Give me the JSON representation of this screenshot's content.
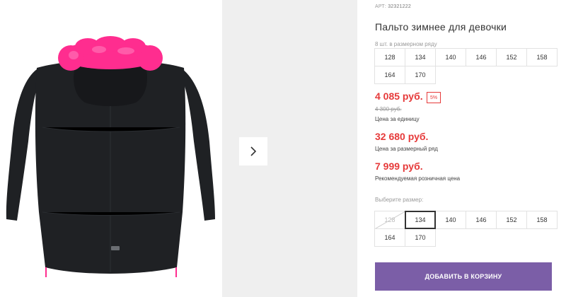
{
  "product": {
    "sku_label": "АРТ:",
    "sku": "32321222",
    "title": "Пальто зимнее для девочки",
    "image_alt": "coat-photo",
    "colors": {
      "accent": "#7b5ea7",
      "price_red": "#e63a3a",
      "coat": "#1f2124",
      "fur": "#ff2d8f"
    }
  },
  "gallery": {
    "next_icon": "chevron-right-icon"
  },
  "pack": {
    "label": "8 шт. в размерном ряду",
    "sizes": [
      "128",
      "134",
      "140",
      "146",
      "152",
      "158",
      "164",
      "170"
    ]
  },
  "prices": {
    "unit": "4 085 руб.",
    "discount": "5%",
    "old": "4 300 руб.",
    "unit_caption": "Цена за единицу",
    "pack": "32 680 руб.",
    "pack_caption": "Цена за размерный ряд",
    "retail": "7 999 руб.",
    "retail_caption": "Рекомендуемая розничная цена"
  },
  "choose": {
    "label": "Выберите размер:",
    "sizes": [
      {
        "value": "128",
        "state": "unavailable"
      },
      {
        "value": "134",
        "state": "selected"
      },
      {
        "value": "140",
        "state": "available"
      },
      {
        "value": "146",
        "state": "available"
      },
      {
        "value": "152",
        "state": "available"
      },
      {
        "value": "158",
        "state": "available"
      },
      {
        "value": "164",
        "state": "available"
      },
      {
        "value": "170",
        "state": "available"
      }
    ]
  },
  "cart_button": "ДОБАВИТЬ В КОРЗИНУ"
}
